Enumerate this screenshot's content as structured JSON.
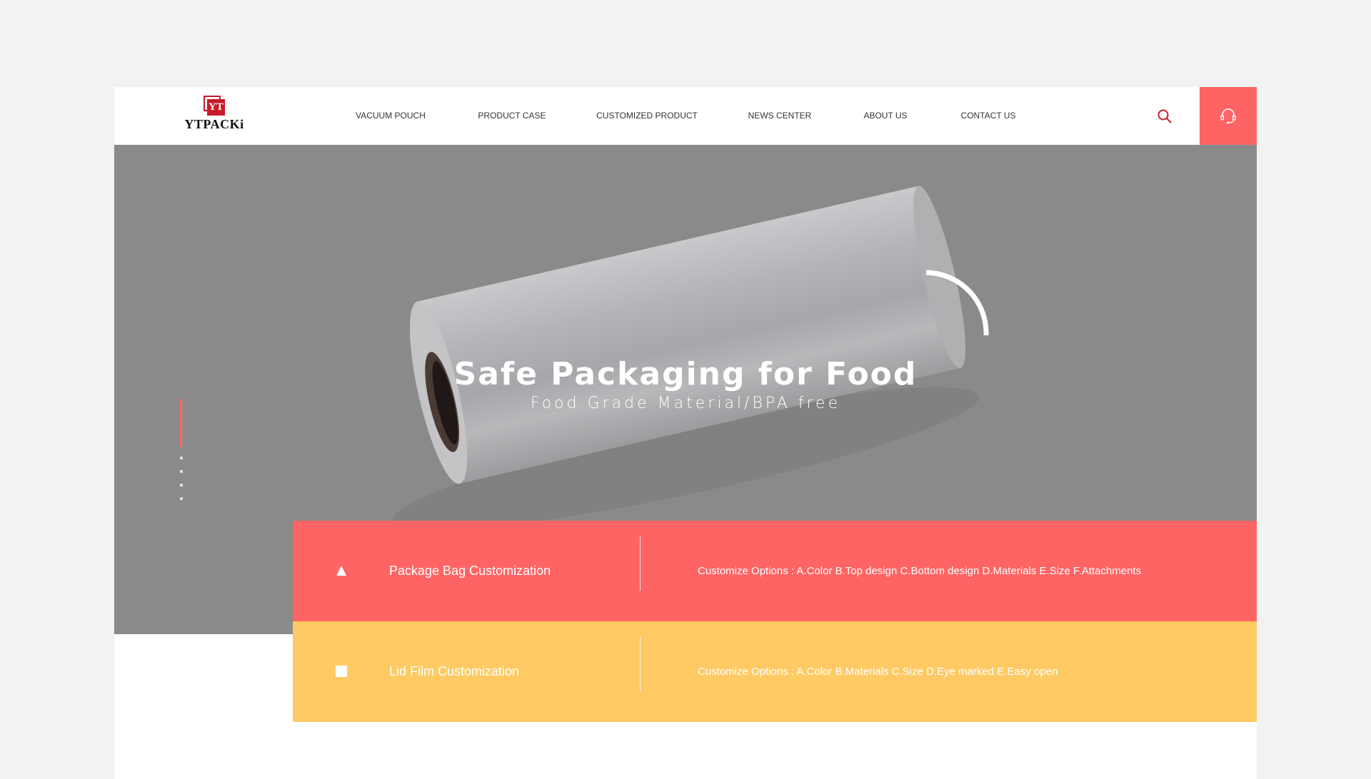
{
  "header": {
    "logo_text": "YTPACKi",
    "logo_mark": "YT",
    "nav": [
      "VACUUM POUCH",
      "PRODUCT CASE",
      "CUSTOMIZED PRODUCT",
      "NEWS CENTER",
      "ABOUT US",
      "CONTACT US"
    ],
    "search_icon": "search-icon",
    "support_icon": "headset-icon"
  },
  "hero": {
    "title": "Safe Packaging for Food",
    "subtitle": "Food Grade Material/BPA free",
    "slides_total": 5,
    "active_slide": 1
  },
  "bands": [
    {
      "icon": "triangle-icon",
      "title": "Package Bag Customization",
      "options": "Customize Options :  A.Color B.Top design C.Bottom design D.Materials E.Size F.Attachments",
      "color": "#ff6464"
    },
    {
      "icon": "square-icon",
      "title": "Lid Film Customization",
      "options": "Customize Options :  A.Color B.Materials C.Size D.Eye marked E.Easy open",
      "color": "#ffca64"
    }
  ],
  "colors": {
    "accent": "#ff6464",
    "search": "#c81a2a",
    "hero_bg": "#8a8a8a"
  }
}
